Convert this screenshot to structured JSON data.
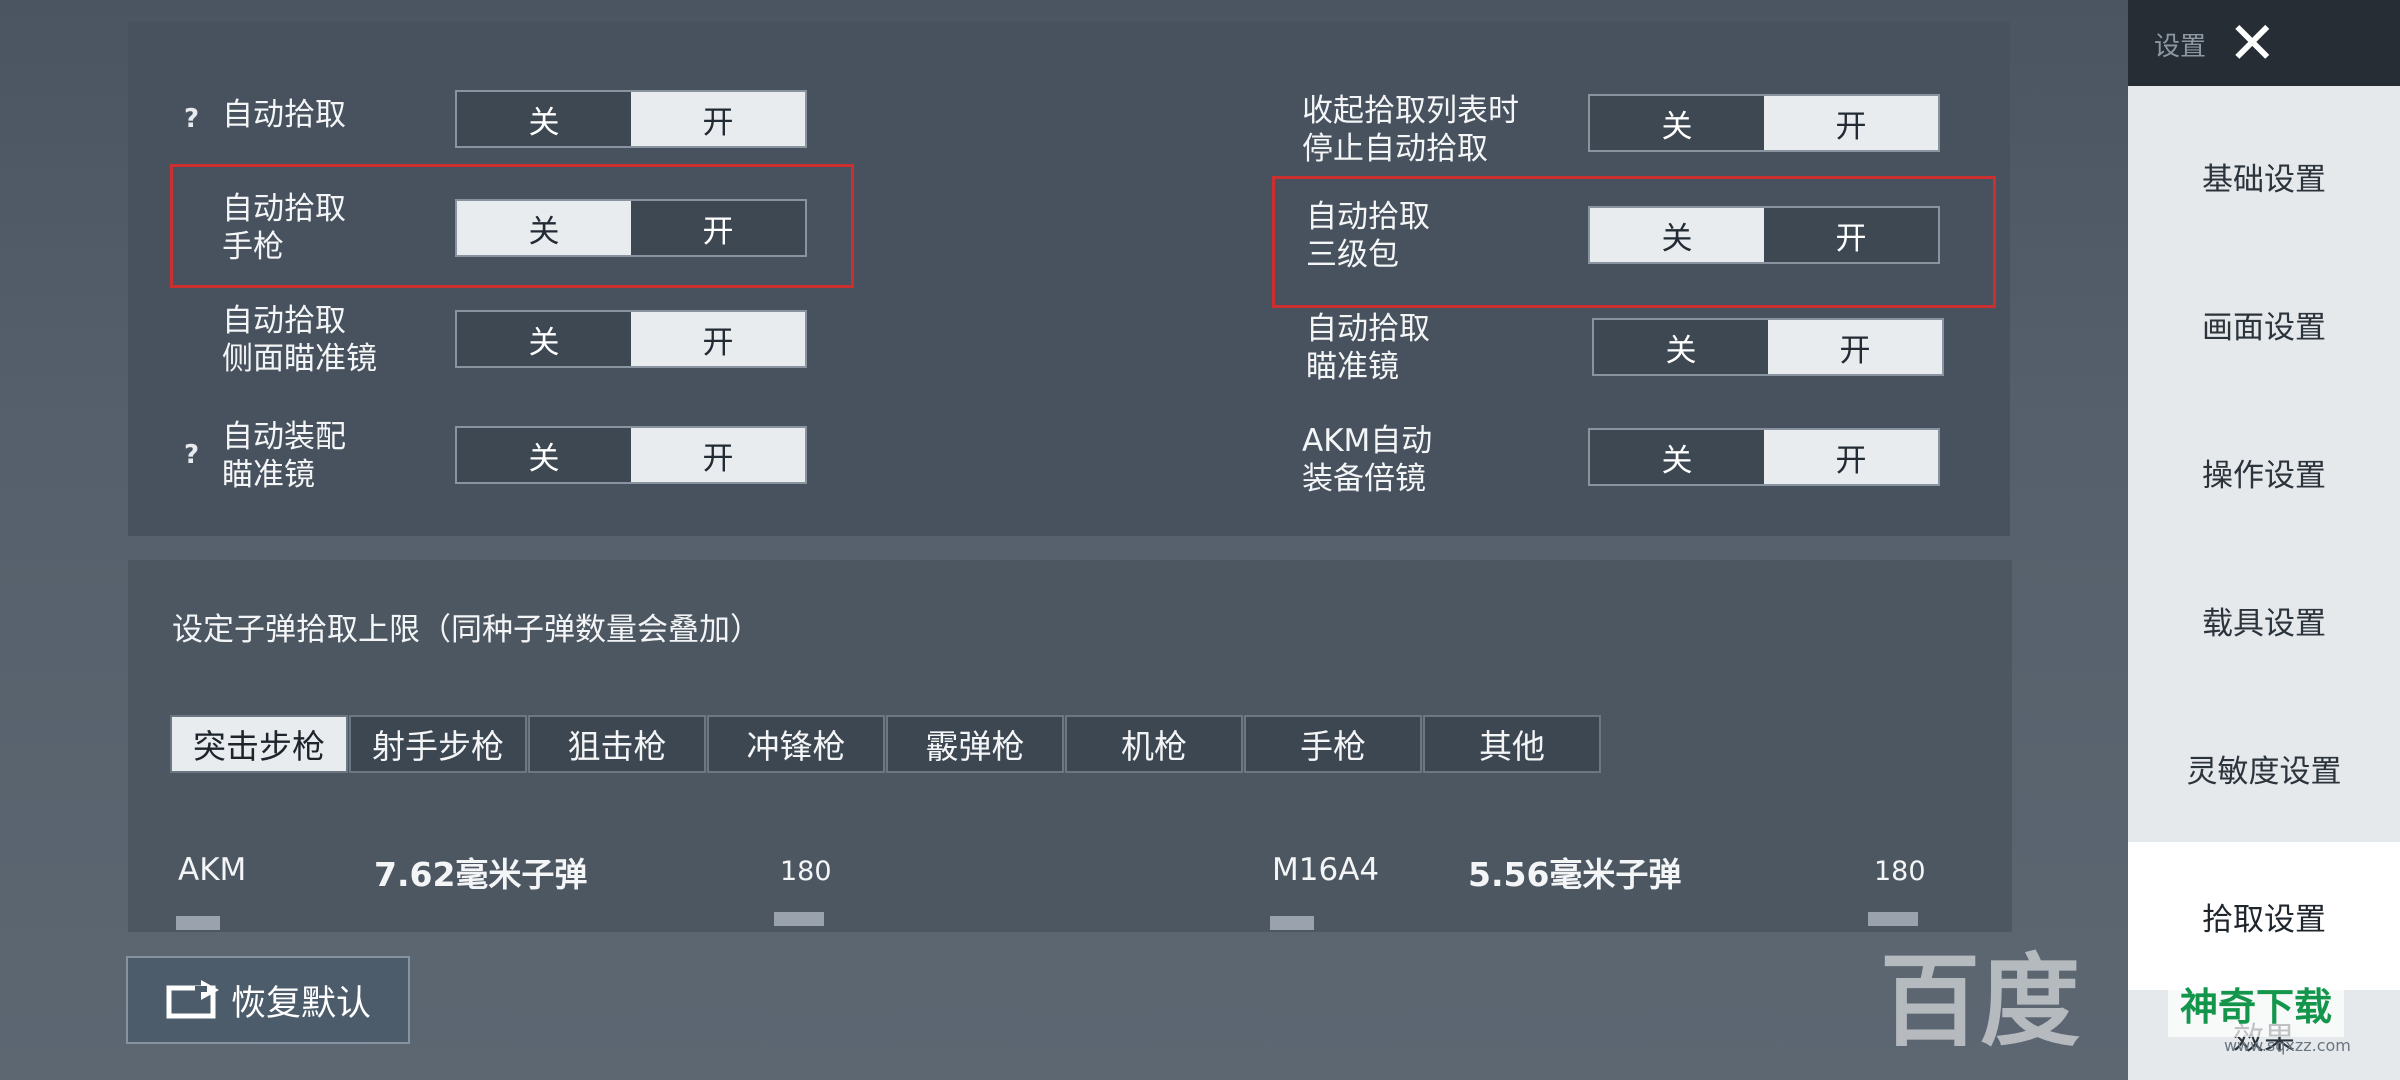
{
  "top_settings": {
    "left": [
      {
        "label": "自动拾取",
        "help": "?",
        "off": "关",
        "on": "开",
        "state": "on"
      },
      {
        "label": "自动拾取\n手枪",
        "off": "关",
        "on": "开",
        "state": "off",
        "highlighted": true
      },
      {
        "label": "自动拾取\n侧面瞄准镜",
        "off": "关",
        "on": "开",
        "state": "on"
      },
      {
        "label": "自动装配\n瞄准镜",
        "help": "?",
        "off": "关",
        "on": "开",
        "state": "on"
      }
    ],
    "right": [
      {
        "label": "收起拾取列表时\n停止自动拾取",
        "off": "关",
        "on": "开",
        "state": "on"
      },
      {
        "label": "自动拾取\n三级包",
        "off": "关",
        "on": "开",
        "state": "off",
        "highlighted": true
      },
      {
        "label": "自动拾取\n瞄准镜",
        "off": "关",
        "on": "开",
        "state": "on"
      },
      {
        "label": "AKM自动\n装备倍镜",
        "off": "关",
        "on": "开",
        "state": "on"
      }
    ]
  },
  "ammo": {
    "title": "设定子弹拾取上限（同种子弹数量会叠加）",
    "tabs": [
      "突击步枪",
      "射手步枪",
      "狙击枪",
      "冲锋枪",
      "霰弹枪",
      "机枪",
      "手枪",
      "其他"
    ],
    "active_tab": "突击步枪",
    "items": [
      {
        "weapon": "AKM",
        "ammo": "7.62毫米子弹",
        "count": "180"
      },
      {
        "weapon": "M16A4",
        "ammo": "5.56毫米子弹",
        "count": "180"
      }
    ]
  },
  "sidebar": {
    "mini_label": "设置",
    "items": [
      "基础设置",
      "画面设置",
      "操作设置",
      "载具设置",
      "灵敏度设置",
      "拾取设置",
      "效果"
    ],
    "active": "拾取设置"
  },
  "restore_button": "恢复默认",
  "watermark": {
    "left": "百度",
    "right": "神奇下载",
    "sub": "www.sqxzz.com"
  },
  "colors": {
    "highlight_border": "#cc2f2f",
    "toggle_active_bg": "#e9ecef",
    "panel_bg": "#48525e"
  }
}
